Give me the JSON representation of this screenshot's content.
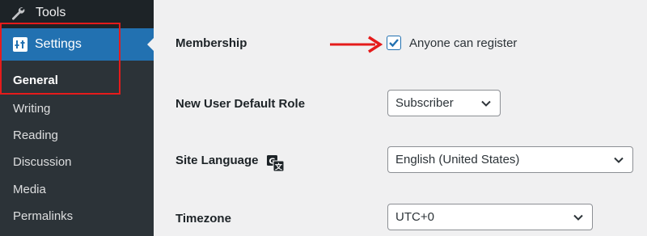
{
  "sidebar": {
    "tools_label": "Tools",
    "settings_label": "Settings",
    "submenu": [
      "General",
      "Writing",
      "Reading",
      "Discussion",
      "Media",
      "Permalinks"
    ],
    "current": "General"
  },
  "form": {
    "membership": {
      "label": "Membership",
      "checkbox_label": "Anyone can register",
      "checked": true
    },
    "default_role": {
      "label": "New User Default Role",
      "value": "Subscriber"
    },
    "site_language": {
      "label": "Site Language",
      "value": "English (United States)"
    },
    "timezone": {
      "label": "Timezone",
      "value": "UTC+0"
    }
  },
  "colors": {
    "sidebar_bg": "#1d2327",
    "submenu_bg": "#2c3338",
    "accent": "#2271b1",
    "annotation_red": "#e51b1b",
    "content_bg": "#f0f0f1"
  },
  "icons": {
    "tools": "wrench-icon",
    "settings": "sliders-icon",
    "language": "translation-icon",
    "dropdown": "chevron-down-icon"
  }
}
